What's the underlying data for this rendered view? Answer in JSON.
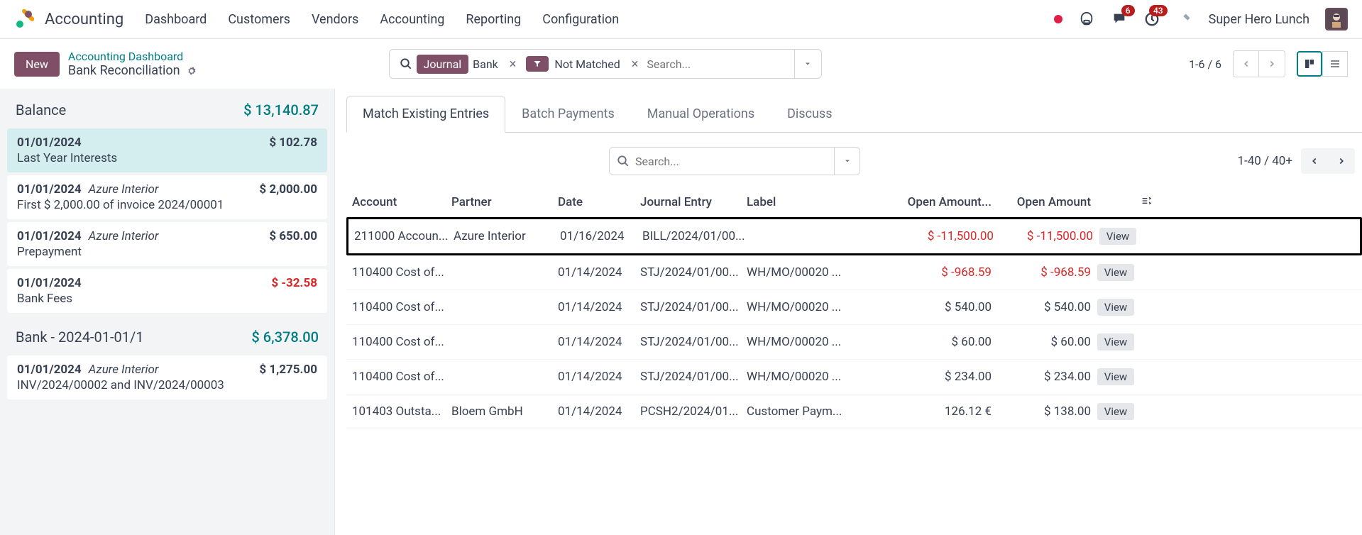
{
  "app_title": "Accounting",
  "topnav": [
    "Dashboard",
    "Customers",
    "Vendors",
    "Accounting",
    "Reporting",
    "Configuration"
  ],
  "msg_badge": "6",
  "activity_badge": "43",
  "user_name": "Super Hero Lunch",
  "new_btn": "New",
  "bc_link": "Accounting Dashboard",
  "bc_current": "Bank Reconciliation",
  "search": {
    "tag_journal": "Journal",
    "tag_bank": "Bank",
    "tag_filter_label": "Not Matched",
    "placeholder": "Search..."
  },
  "pager_top": "1-6 / 6",
  "balance": {
    "label": "Balance",
    "amount": "$ 13,140.87"
  },
  "statements": [
    {
      "date": "01/01/2024",
      "partner": "",
      "amount": "$ 102.78",
      "desc": "Last Year Interests",
      "selected": true,
      "neg": false
    },
    {
      "date": "01/01/2024",
      "partner": "Azure Interior",
      "amount": "$ 2,000.00",
      "desc": "First $ 2,000.00 of invoice 2024/00001",
      "selected": false,
      "neg": false
    },
    {
      "date": "01/01/2024",
      "partner": "Azure Interior",
      "amount": "$ 650.00",
      "desc": "Prepayment",
      "selected": false,
      "neg": false
    },
    {
      "date": "01/01/2024",
      "partner": "",
      "amount": "$ -32.58",
      "desc": "Bank Fees",
      "selected": false,
      "neg": true
    }
  ],
  "section": {
    "label": "Bank - 2024-01-01/1",
    "amount": "$ 6,378.00"
  },
  "statements2": [
    {
      "date": "01/01/2024",
      "partner": "Azure Interior",
      "amount": "$ 1,275.00",
      "desc": "INV/2024/00002 and INV/2024/00003",
      "neg": false
    }
  ],
  "tabs": [
    "Match Existing Entries",
    "Batch Payments",
    "Manual Operations",
    "Discuss"
  ],
  "table_search_placeholder": "Search...",
  "table_pager": "1-40 / 40+",
  "columns": {
    "account": "Account",
    "partner": "Partner",
    "date": "Date",
    "journal": "Journal Entry",
    "label": "Label",
    "open1": "Open Amount...",
    "open2": "Open Amount"
  },
  "rows": [
    {
      "account": "211000 Accoun...",
      "partner": "Azure Interior",
      "date": "01/16/2024",
      "journal": "BILL/2024/01/00...",
      "label": "",
      "open1": "$ -11,500.00",
      "open2": "$ -11,500.00",
      "neg": true,
      "highlight": true
    },
    {
      "account": "110400 Cost of...",
      "partner": "",
      "date": "01/14/2024",
      "journal": "STJ/2024/01/00...",
      "label": "WH/MO/00020 ...",
      "open1": "$ -968.59",
      "open2": "$ -968.59",
      "neg": true,
      "highlight": false
    },
    {
      "account": "110400 Cost of...",
      "partner": "",
      "date": "01/14/2024",
      "journal": "STJ/2024/01/00...",
      "label": "WH/MO/00020 ...",
      "open1": "$ 540.00",
      "open2": "$ 540.00",
      "neg": false,
      "highlight": false
    },
    {
      "account": "110400 Cost of...",
      "partner": "",
      "date": "01/14/2024",
      "journal": "STJ/2024/01/00...",
      "label": "WH/MO/00020 ...",
      "open1": "$ 60.00",
      "open2": "$ 60.00",
      "neg": false,
      "highlight": false
    },
    {
      "account": "110400 Cost of...",
      "partner": "",
      "date": "01/14/2024",
      "journal": "STJ/2024/01/00...",
      "label": "WH/MO/00020 ...",
      "open1": "$ 234.00",
      "open2": "$ 234.00",
      "neg": false,
      "highlight": false
    },
    {
      "account": "101403 Outsta...",
      "partner": "Bloem GmbH",
      "date": "01/14/2024",
      "journal": "PCSH2/2024/01...",
      "label": "Customer Paym...",
      "open1": "126.12 €",
      "open2": "$ 138.00",
      "neg": false,
      "highlight": false
    }
  ],
  "view_label": "View"
}
